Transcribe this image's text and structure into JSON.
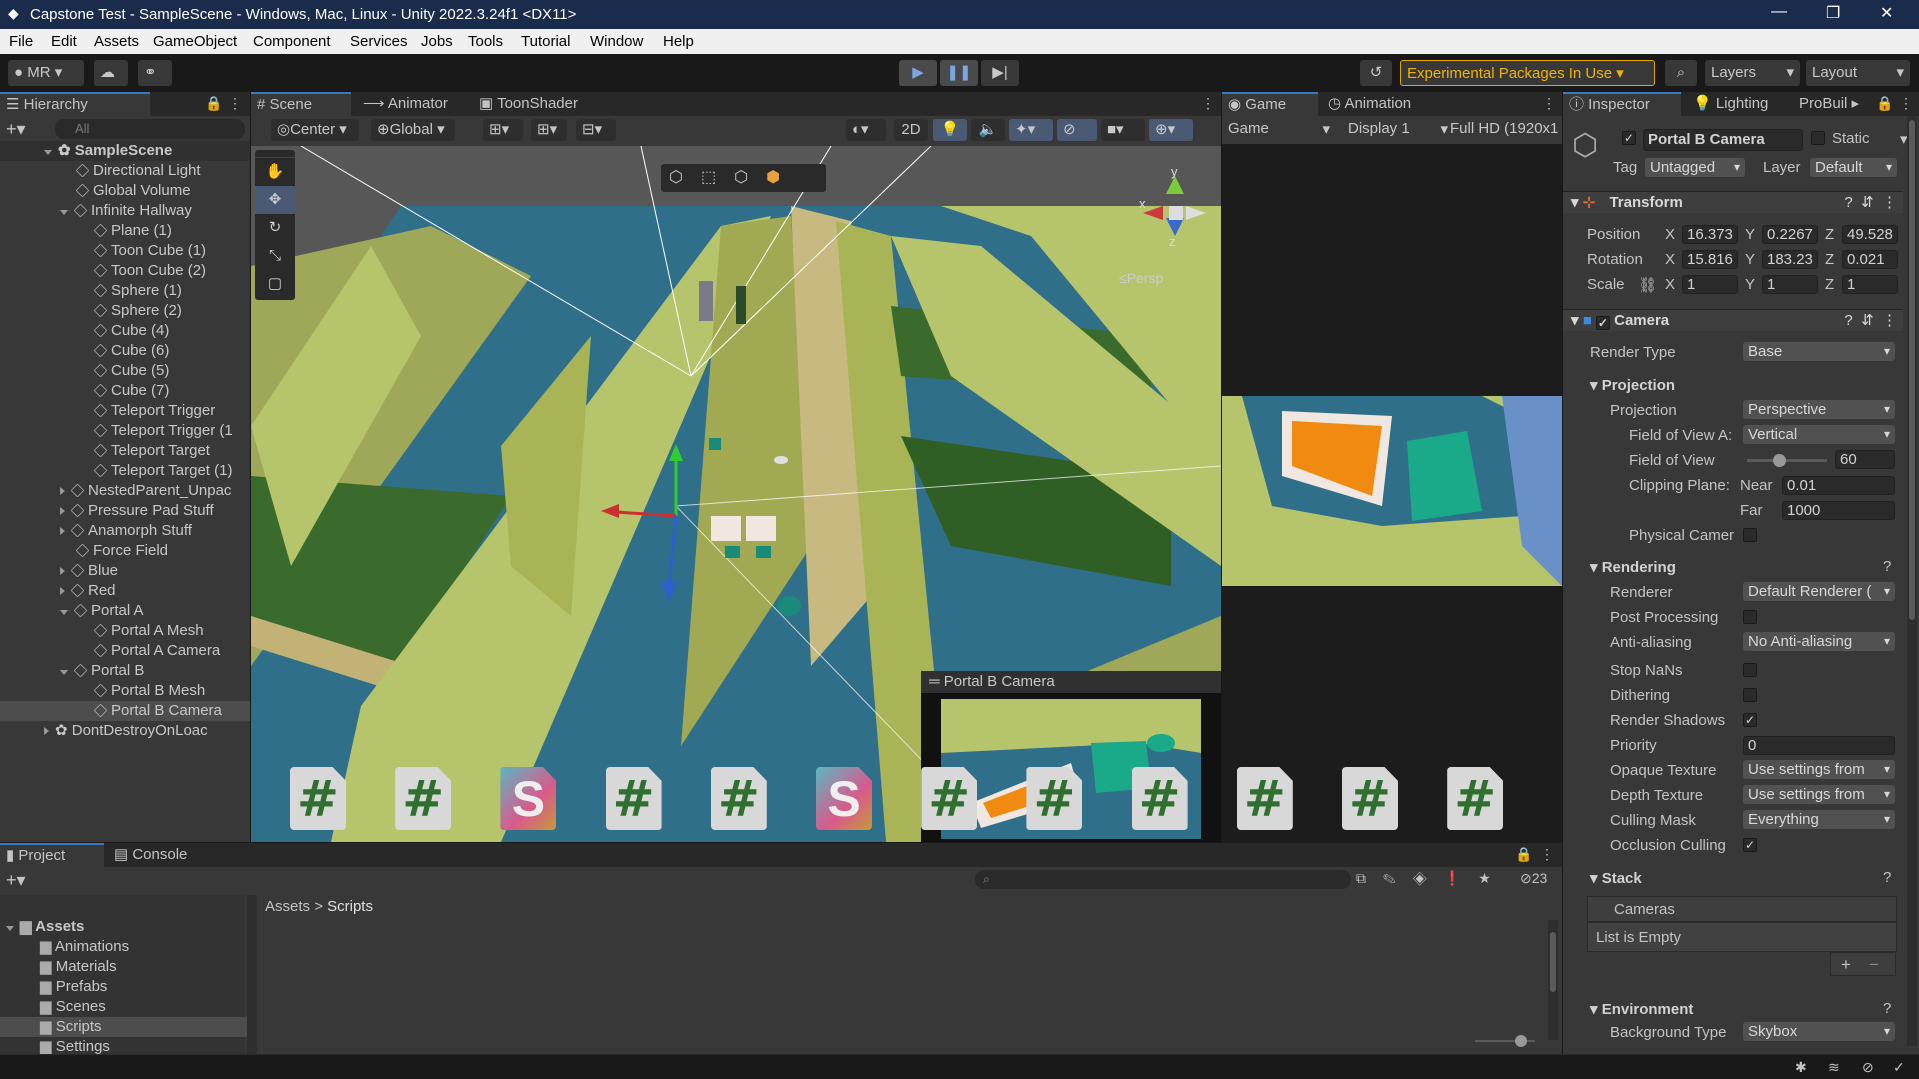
{
  "window": {
    "title": "Capstone Test - SampleScene - Windows, Mac, Linux - Unity 2022.3.24f1 <DX11>",
    "min": "—",
    "max": "❐",
    "close": "✕"
  },
  "menu": [
    "File",
    "Edit",
    "Assets",
    "GameObject",
    "Component",
    "Services",
    "Jobs",
    "Tools",
    "Tutorial",
    "Window",
    "Help"
  ],
  "toolbar": {
    "account": "MR",
    "packages": "Experimental Packages In Use",
    "layers": "Layers",
    "layout": "Layout"
  },
  "hierarchy": {
    "tab": "Hierarchy",
    "search_placeholder": "All",
    "scene": "SampleScene",
    "items": [
      "Directional Light",
      "Global Volume",
      "Infinite Hallway",
      "Plane (1)",
      "Toon Cube (1)",
      "Toon Cube (2)",
      "Sphere (1)",
      "Sphere (2)",
      "Cube (4)",
      "Cube (6)",
      "Cube (5)",
      "Cube (7)",
      "Teleport Trigger",
      "Teleport Trigger (1",
      "Teleport Target",
      "Teleport Target (1)",
      "NestedParent_Unpac",
      "Pressure Pad Stuff",
      "Anamorph Stuff",
      "Force Field",
      "Blue",
      "Red",
      "Portal A",
      "Portal A Mesh",
      "Portal A Camera",
      "Portal B",
      "Portal B Mesh",
      "Portal B Camera",
      "DontDestroyOnLoac"
    ]
  },
  "scene": {
    "tabs": [
      "Scene",
      "Animator",
      "ToonShader"
    ],
    "pivot": "Center",
    "space": "Global",
    "mode2d": "2D",
    "persp": "Persp",
    "preview_title": "Portal B Camera",
    "gizmo_y": "y",
    "gizmo_x": "x",
    "gizmo_z": "z"
  },
  "game": {
    "tabs": [
      "Game",
      "Animation"
    ],
    "mode": "Game",
    "display": "Display 1",
    "resolution": "Full HD (1920x1"
  },
  "inspector": {
    "tabs": [
      "Inspector",
      "Lighting",
      "ProBuil"
    ],
    "object_name": "Portal B Camera",
    "static": "Static",
    "tag_label": "Tag",
    "tag": "Untagged",
    "layer_label": "Layer",
    "layer": "Default",
    "transform": {
      "title": "Transform",
      "position": {
        "label": "Position",
        "x": "16.373",
        "y": "0.2267",
        "z": "49.528"
      },
      "rotation": {
        "label": "Rotation",
        "x": "15.816",
        "y": "183.23",
        "z": "0.021"
      },
      "scale": {
        "label": "Scale",
        "x": "1",
        "y": "1",
        "z": "1"
      },
      "axis_x": "X",
      "axis_y": "Y",
      "axis_z": "Z"
    },
    "camera": {
      "title": "Camera",
      "render_type_label": "Render Type",
      "render_type": "Base",
      "projection_head": "Projection",
      "projection_label": "Projection",
      "projection": "Perspective",
      "fov_axis_label": "Field of View A:",
      "fov_axis": "Vertical",
      "fov_label": "Field of View",
      "fov": "60",
      "fov_slider": 0.4,
      "clip_label": "Clipping Plane:",
      "near_label": "Near",
      "near": "0.01",
      "far_label": "Far",
      "far": "1000",
      "physical_label": "Physical Camer",
      "rendering_head": "Rendering",
      "renderer_label": "Renderer",
      "renderer": "Default Renderer (",
      "postproc_label": "Post Processing",
      "aa_label": "Anti-aliasing",
      "aa": "No Anti-aliasing",
      "nans_label": "Stop NaNs",
      "dither_label": "Dithering",
      "shadows_label": "Render Shadows",
      "priority_label": "Priority",
      "priority": "0",
      "opaque_label": "Opaque Texture",
      "opaque": "Use settings from",
      "depth_label": "Depth Texture",
      "depth": "Use settings from",
      "culling_label": "Culling Mask",
      "culling": "Everything",
      "occlusion_label": "Occlusion Culling",
      "stack_head": "Stack",
      "stack_cameras": "Cameras",
      "stack_empty": "List is Empty",
      "plus": "+",
      "minus": "−",
      "env_head": "Environment",
      "bg_label": "Background Type",
      "bg": "Skybox"
    }
  },
  "project": {
    "tabs": [
      "Project",
      "Console"
    ],
    "count": "23",
    "breadcrumb_root": "Assets",
    "breadcrumb_sep": ">",
    "breadcrumb_leaf": "Scripts",
    "tree_root": "Assets",
    "folders": [
      "Animations",
      "Materials",
      "Prefabs",
      "Scenes",
      "Scripts",
      "Settings"
    ],
    "assets": [
      "#",
      "#",
      "S",
      "#",
      "#",
      "S",
      "#",
      "#",
      "#",
      "#",
      "#",
      "#"
    ]
  },
  "colors": {
    "titlebar": "#1b2b4c",
    "accent": "#3a79bb",
    "panel": "#383838",
    "sky": "#5a5a5a",
    "floor": "#2f6f8a",
    "wall": "#b8c06a"
  }
}
